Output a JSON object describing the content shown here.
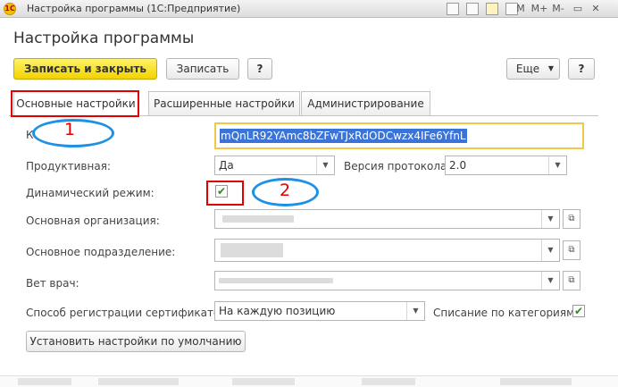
{
  "window": {
    "title": "Настройка программы (1С:Предприятие)",
    "logo_text": "1С",
    "controls": [
      "M",
      "M+",
      "M-"
    ]
  },
  "form": {
    "title": "Настройка программы"
  },
  "toolbar": {
    "save_close_label": "Записать и закрыть",
    "save_label": "Записать",
    "help_label": "?",
    "more_label": "Еще",
    "help2_label": "?"
  },
  "tabs": [
    {
      "label": "Основные настройки",
      "active": true
    },
    {
      "label": "Расширенные настройки",
      "active": false
    },
    {
      "label": "Администрирование",
      "active": false
    }
  ],
  "fields": {
    "key": {
      "label": "К",
      "value": "mQnLR92YAmc8bZFwTJxRdODCwzx4IFe6YfnL"
    },
    "productive": {
      "label": "Продуктивная:",
      "value": "Да"
    },
    "protocol": {
      "label": "Версия протокола:",
      "value": "2.0"
    },
    "dynamic_mode": {
      "label": "Динамический режим:",
      "checked": true
    },
    "organization": {
      "label": "Основная организация:"
    },
    "subdivision": {
      "label": "Основное подразделение:"
    },
    "vet": {
      "label": "Вет врач:"
    },
    "cert_method": {
      "label": "Способ регистрации сертификатов:",
      "value": "На каждую позицию"
    },
    "writeoff_by_category": {
      "label": "Списание по категориям:",
      "checked": true
    }
  },
  "defaults_button_label": "Установить настройки по умолчанию",
  "annotations": {
    "marker1": "1",
    "marker2": "2",
    "accent_red": "#e00000",
    "accent_blue": "#1e90e6"
  },
  "colors": {
    "primary_button": "#f2d300",
    "focus_border": "#f1c84a",
    "selection": "#3b74d8",
    "check": "#2d8a1e"
  }
}
